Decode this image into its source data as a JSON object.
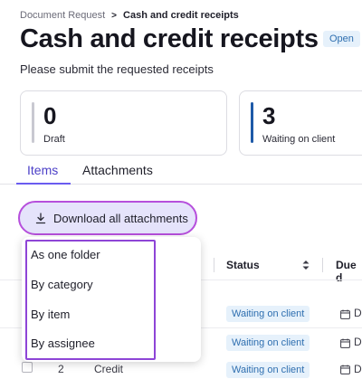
{
  "breadcrumb": {
    "parent": "Document Request",
    "separator": ">",
    "current": "Cash and credit receipts"
  },
  "page": {
    "title": "Cash and credit receipts",
    "status_badge": "Open",
    "subtitle": "Please submit the requested receipts"
  },
  "stats": [
    {
      "value": "0",
      "label": "Draft",
      "color": "#c9c9d1"
    },
    {
      "value": "3",
      "label": "Waiting on client",
      "color": "#1e5aa8"
    }
  ],
  "tabs": [
    {
      "label": "Items",
      "active": true
    },
    {
      "label": "Attachments",
      "active": false
    }
  ],
  "download_button": {
    "label": "Download all attachments",
    "icon": "download-icon"
  },
  "dropdown": {
    "items": [
      "As one folder",
      "By category",
      "By item",
      "By assignee"
    ]
  },
  "table": {
    "headers": {
      "status": "Status",
      "due": "Due d"
    },
    "rows": [
      {
        "status": "Waiting on client",
        "due_icon": "calendar-icon",
        "due": "D"
      },
      {
        "status": "Waiting on client",
        "due_icon": "calendar-icon",
        "due": "D"
      },
      {
        "index": "2",
        "name": "Credit",
        "status": "Waiting on client",
        "due_icon": "calendar-icon",
        "due": "D"
      }
    ]
  },
  "colors": {
    "accent": "#6a5cf0",
    "highlight_outline": "#b64fdc",
    "status_blue": "#2f6fb0"
  }
}
